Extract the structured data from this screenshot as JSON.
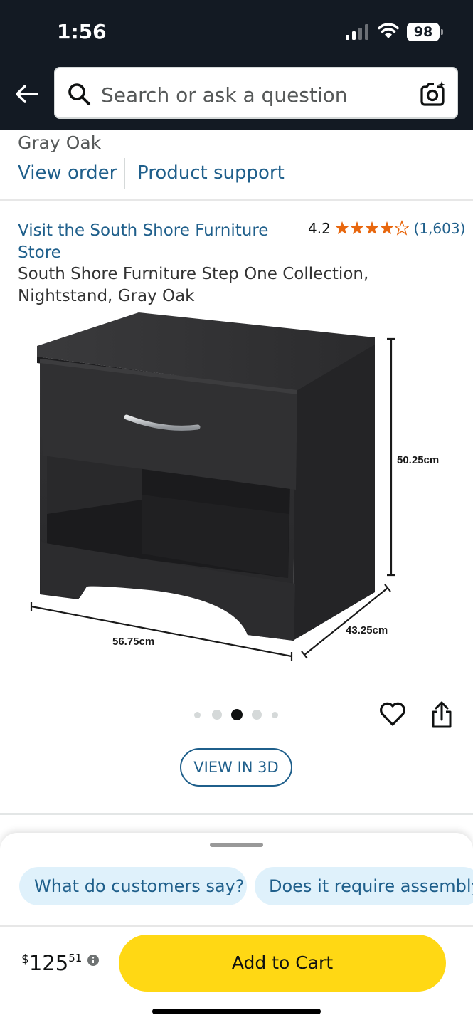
{
  "status_bar": {
    "time": "1:56",
    "battery": "98"
  },
  "search": {
    "placeholder": "Search or ask a question"
  },
  "order": {
    "variant": "Gray Oak",
    "view_order": "View order",
    "product_support": "Product support"
  },
  "product": {
    "store_link": "Visit the South Shore Furniture Store",
    "rating": "4.2",
    "stars": 4.2,
    "review_count": "(1,603)",
    "title": "South Shore Furniture Step One Collection, Nightstand, Gray Oak",
    "dimensions": {
      "height": "50.25cm",
      "width": "56.75cm",
      "depth": "43.25cm"
    },
    "image_index": 3,
    "image_count": 5,
    "view_3d": "VIEW IN 3D"
  },
  "questions": [
    "What do customers say?",
    "Does it require assembly"
  ],
  "buy": {
    "currency": "$",
    "price_whole": "125",
    "price_fraction": "51",
    "add_to_cart": "Add to Cart"
  },
  "colors": {
    "header_bg": "#131a23",
    "link": "#1f5f8b",
    "cart_button": "#ffd814",
    "star": "#e8670e",
    "chip_bg": "#dff1fb"
  },
  "icons": [
    "back-arrow-icon",
    "search-icon",
    "camera-icon",
    "heart-icon",
    "share-icon",
    "info-icon"
  ]
}
